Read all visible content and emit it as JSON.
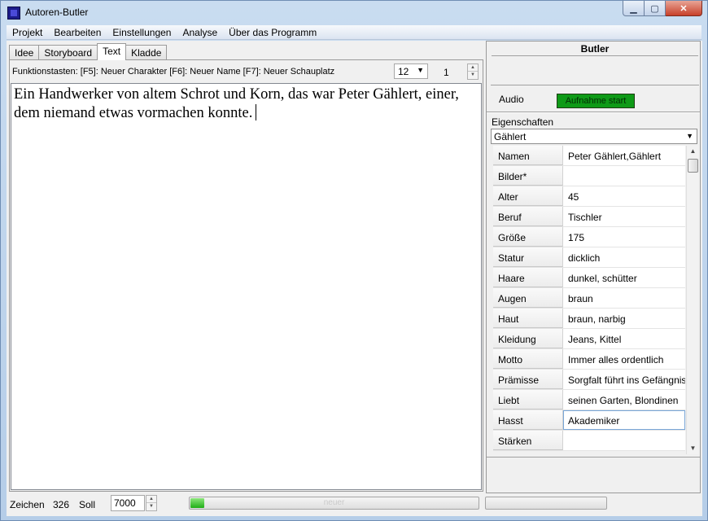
{
  "window": {
    "title": "Autoren-Butler"
  },
  "menu": [
    "Projekt",
    "Bearbeiten",
    "Einstellungen",
    "Analyse",
    "Über das Programm"
  ],
  "tabs": [
    {
      "label": "Idee",
      "active": false
    },
    {
      "label": "Storyboard",
      "active": false
    },
    {
      "label": "Text",
      "active": true
    },
    {
      "label": "Kladde",
      "active": false
    }
  ],
  "toolbar": {
    "function_keys": "Funktionstasten: [F5]: Neuer Charakter [F6]: Neuer Name [F7]: Neuer Schauplatz",
    "font_size": "12",
    "page": "1"
  },
  "editor": {
    "text": "Ein Handwerker von altem Schrot und Korn, das war Peter Gählert, einer, dem niemand etwas vormachen konnte."
  },
  "butler": {
    "title": "Butler",
    "audio_label": "Audio",
    "record_button": "Aufnahme start",
    "record_color": "#0e9a17",
    "properties_label": "Eigenschaften",
    "selected_character": "Gählert",
    "properties": [
      {
        "name": "Namen",
        "value": "Peter Gählert,Gählert"
      },
      {
        "name": "Bilder*",
        "value": ""
      },
      {
        "name": "Alter",
        "value": "45"
      },
      {
        "name": "Beruf",
        "value": "Tischler"
      },
      {
        "name": "Größe",
        "value": "175"
      },
      {
        "name": "Statur",
        "value": "dicklich"
      },
      {
        "name": "Haare",
        "value": "dunkel, schütter"
      },
      {
        "name": "Augen",
        "value": "braun"
      },
      {
        "name": "Haut",
        "value": "braun, narbig"
      },
      {
        "name": "Kleidung",
        "value": "Jeans, Kittel"
      },
      {
        "name": "Motto",
        "value": "Immer alles ordentlich"
      },
      {
        "name": "Prämisse",
        "value": "Sorgfalt führt ins Gefängnis"
      },
      {
        "name": "Liebt",
        "value": "seinen Garten, Blondinen"
      },
      {
        "name": "Hasst",
        "value": "Akademiker"
      },
      {
        "name": "Stärken",
        "value": ""
      }
    ]
  },
  "status": {
    "chars_label": "Zeichen",
    "chars_value": "326",
    "target_label": "Soll",
    "target_value": "7000",
    "progress_text": "neuer",
    "progress_fraction": 0.047
  }
}
